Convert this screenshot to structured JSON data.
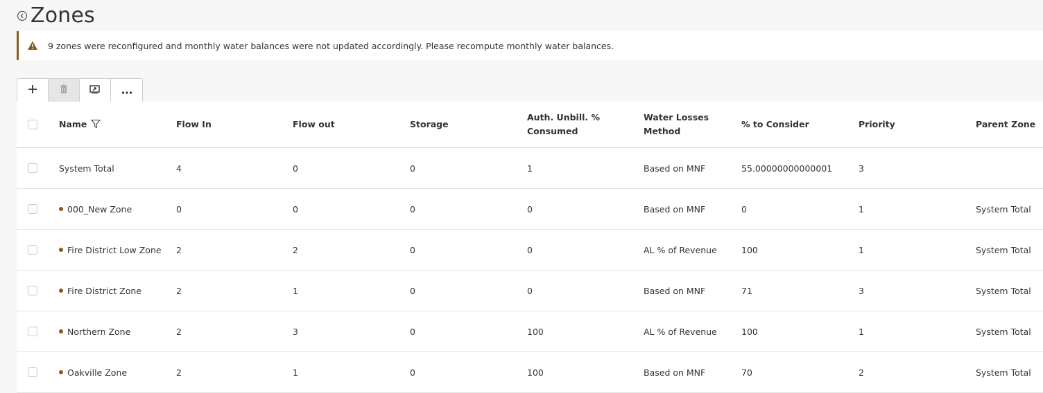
{
  "page": {
    "title": "Zones"
  },
  "alert": {
    "message": "9 zones were reconfigured and monthly water balances were not updated accordingly. Please recompute monthly water balances.",
    "color": "#8a5a1b"
  },
  "toolbar": {
    "buttons": [
      {
        "icon": "plus-icon",
        "glyph": "+",
        "enabled": true
      },
      {
        "icon": "trash-icon",
        "enabled": false
      },
      {
        "icon": "export-icon",
        "enabled": true
      },
      {
        "icon": "more-icon",
        "glyph": "•••",
        "enabled": true
      }
    ]
  },
  "table": {
    "columns": [
      "Name",
      "Flow In",
      "Flow out",
      "Storage",
      "Auth. Unbill. %",
      "Consumed",
      "Water Losses",
      "Method",
      "% to Consider",
      "Priority",
      "Parent Zone"
    ],
    "rows": [
      {
        "name": "System Total",
        "dot": false,
        "flow_in": "4",
        "flow_out": "0",
        "storage": "0",
        "auth": "1",
        "method": "Based on MNF",
        "consider": "55.00000000000001",
        "priority": "3",
        "parent": ""
      },
      {
        "name": "000_New Zone",
        "dot": true,
        "flow_in": "0",
        "flow_out": "0",
        "storage": "0",
        "auth": "0",
        "method": "Based on MNF",
        "consider": "0",
        "priority": "1",
        "parent": "System Total"
      },
      {
        "name": "Fire District Low Zone",
        "dot": true,
        "flow_in": "2",
        "flow_out": "2",
        "storage": "0",
        "auth": "0",
        "method": "AL % of Revenue",
        "consider": "100",
        "priority": "1",
        "parent": "System Total"
      },
      {
        "name": "Fire District Zone",
        "dot": true,
        "flow_in": "2",
        "flow_out": "1",
        "storage": "0",
        "auth": "0",
        "method": "Based on MNF",
        "consider": "71",
        "priority": "3",
        "parent": "System Total"
      },
      {
        "name": "Northern Zone",
        "dot": true,
        "flow_in": "2",
        "flow_out": "3",
        "storage": "0",
        "auth": "100",
        "method": "AL % of Revenue",
        "consider": "100",
        "priority": "1",
        "parent": "System Total"
      },
      {
        "name": "Oakville Zone",
        "dot": true,
        "flow_in": "2",
        "flow_out": "1",
        "storage": "0",
        "auth": "100",
        "method": "Based on MNF",
        "consider": "70",
        "priority": "2",
        "parent": "System Total"
      }
    ]
  }
}
